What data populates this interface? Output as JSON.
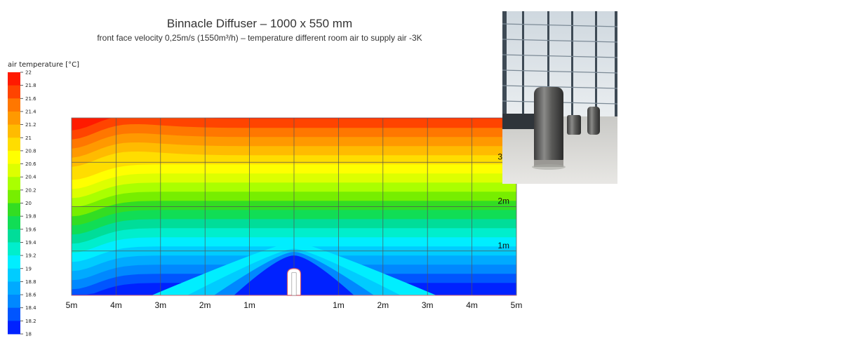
{
  "title": "Binnacle Diffuser – 1000 x 550 mm",
  "subtitle": "front face velocity 0,25m/s (1550m³/h) – temperature different room air to supply air -3K",
  "legend": {
    "title": "air temperature [°C]",
    "ticks": [
      "22",
      "21.8",
      "21.6",
      "21.4",
      "21.2",
      "21",
      "20.8",
      "20.6",
      "20.4",
      "20.2",
      "20",
      "19.8",
      "19.6",
      "19.4",
      "19.2",
      "19",
      "18.8",
      "18.6",
      "18.4",
      "18.2",
      "18"
    ],
    "colors": [
      "#ff1a00",
      "#ff4400",
      "#ff7700",
      "#ff9900",
      "#ffbb00",
      "#ffdd00",
      "#ffff00",
      "#ddff00",
      "#aaff00",
      "#77ee00",
      "#33dd22",
      "#11dd55",
      "#00dd99",
      "#00eecc",
      "#00eeff",
      "#00ccff",
      "#00aaff",
      "#0088ff",
      "#0055ff",
      "#0022ff"
    ]
  },
  "chart_data": {
    "type": "heatmap",
    "title": "Binnacle Diffuser – 1000 x 550 mm",
    "subtitle": "front face velocity 0,25m/s (1550m³/h) – temperature different room air to supply air -3K",
    "colorbar_label": "air temperature [°C]",
    "colorbar_range": [
      18,
      22
    ],
    "colorbar_step": 0.2,
    "x_ticks": [
      "5m",
      "4m",
      "3m",
      "2m",
      "1m",
      "",
      "1m",
      "2m",
      "3m",
      "4m",
      "5m"
    ],
    "height_labels": [
      "3m",
      "2m",
      "1m"
    ],
    "x_range_m": [
      -5,
      5
    ],
    "y_range_m": [
      0,
      4
    ],
    "grid": true,
    "diffuser": {
      "name": "Binnacle Diffuser",
      "width_mm": 1000,
      "height_mm": 550
    }
  },
  "photo": {
    "icon": "binnacle-diffuser-photo"
  }
}
